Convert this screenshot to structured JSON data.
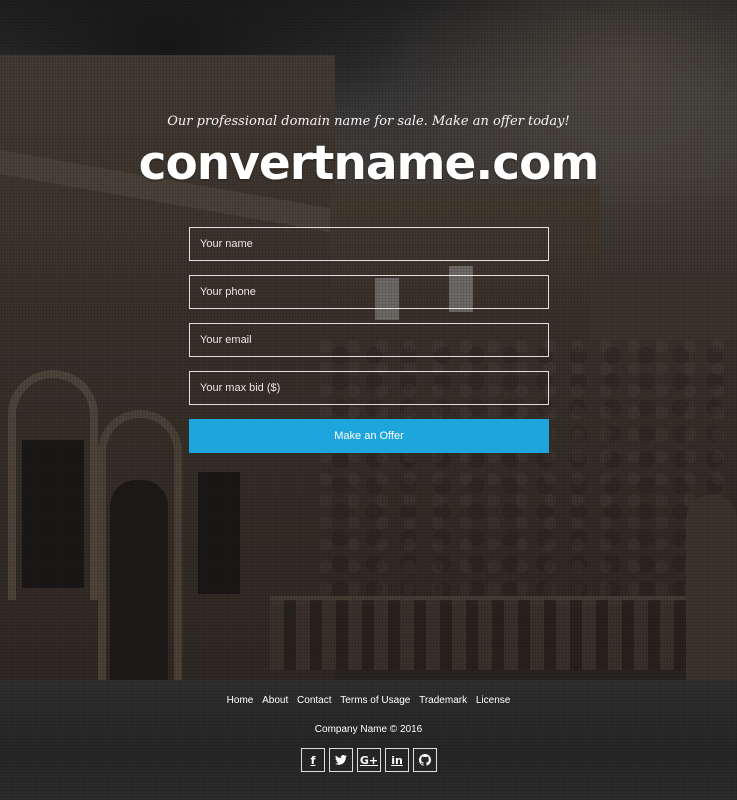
{
  "hero": {
    "tagline": "Our professional domain name for sale. Make an offer today!",
    "domain": "convertname.com"
  },
  "form": {
    "name_placeholder": "Your name",
    "phone_placeholder": "Your phone",
    "email_placeholder": "Your email",
    "bid_placeholder": "Your max bid ($)",
    "submit_label": "Make an Offer"
  },
  "footer": {
    "links": [
      "Home",
      "About",
      "Contact",
      "Terms of Usage",
      "Trademark",
      "License"
    ],
    "copyright": "Company Name © 2016"
  },
  "social": [
    {
      "icon": "facebook-icon",
      "glyph": "f"
    },
    {
      "icon": "twitter-icon",
      "glyph": "🐦"
    },
    {
      "icon": "google-plus-icon",
      "glyph": "G+"
    },
    {
      "icon": "linkedin-icon",
      "glyph": "in"
    },
    {
      "icon": "github-icon",
      "glyph": "◉"
    }
  ],
  "colors": {
    "accent": "#1ea5dd"
  }
}
